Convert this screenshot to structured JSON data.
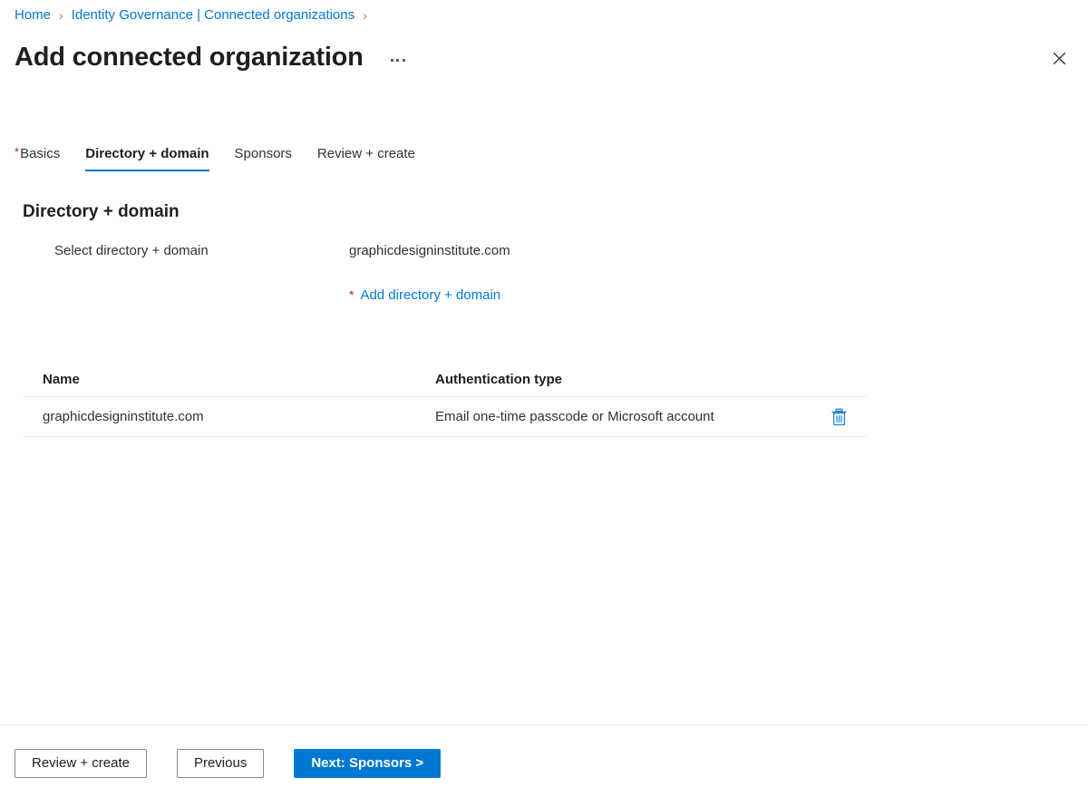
{
  "breadcrumb": {
    "items": [
      {
        "label": "Home"
      },
      {
        "label": "Identity Governance | Connected organizations"
      }
    ],
    "separator": "›"
  },
  "header": {
    "title": "Add connected organization",
    "more_menu": "more-commands",
    "close": "close"
  },
  "tabs": [
    {
      "label": "Basics",
      "required": true,
      "active": false
    },
    {
      "label": "Directory + domain",
      "required": false,
      "active": true
    },
    {
      "label": "Sponsors",
      "required": false,
      "active": false
    },
    {
      "label": "Review + create",
      "required": false,
      "active": false
    }
  ],
  "section": {
    "title": "Directory + domain",
    "field_label": "Select directory + domain",
    "field_value": "graphicdesigninstitute.com",
    "add_link": "Add directory + domain",
    "add_link_required_marker": "*"
  },
  "table": {
    "columns": [
      "Name",
      "Authentication type"
    ],
    "rows": [
      {
        "name": "graphicdesigninstitute.com",
        "auth_type": "Email one-time passcode or Microsoft account",
        "action": "delete"
      }
    ]
  },
  "footer": {
    "review_create": "Review + create",
    "previous": "Previous",
    "next": "Next: Sponsors >"
  },
  "colors": {
    "accent": "#0078d4",
    "required": "#a4262c",
    "text": "#323130",
    "border": "#edebe9"
  }
}
